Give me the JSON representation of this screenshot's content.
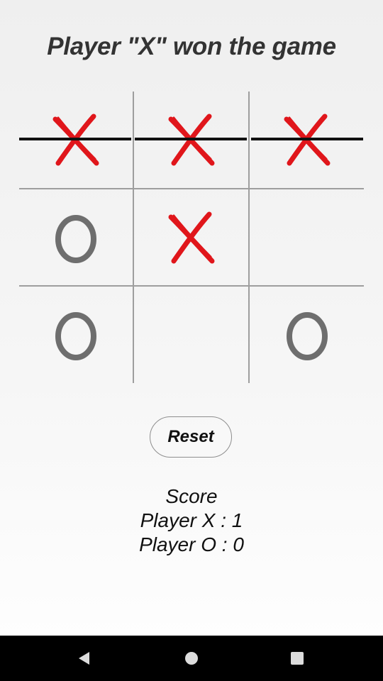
{
  "game": {
    "status_text": "Player \"X\" won the game",
    "board": [
      [
        "X",
        "X",
        "X"
      ],
      [
        "O",
        "X",
        ""
      ],
      [
        "O",
        "",
        "O"
      ]
    ],
    "winning_line": "top-row",
    "x_color": "#e0161b",
    "o_color": "#6e6e6e",
    "grid_color": "#9e9e9e"
  },
  "controls": {
    "reset_label": "Reset"
  },
  "score": {
    "heading": "Score",
    "player_x": "Player X : 1",
    "player_o": "Player O : 0"
  },
  "navbar": {
    "icons": [
      "back-triangle-icon",
      "home-circle-icon",
      "recent-apps-square-icon"
    ]
  }
}
